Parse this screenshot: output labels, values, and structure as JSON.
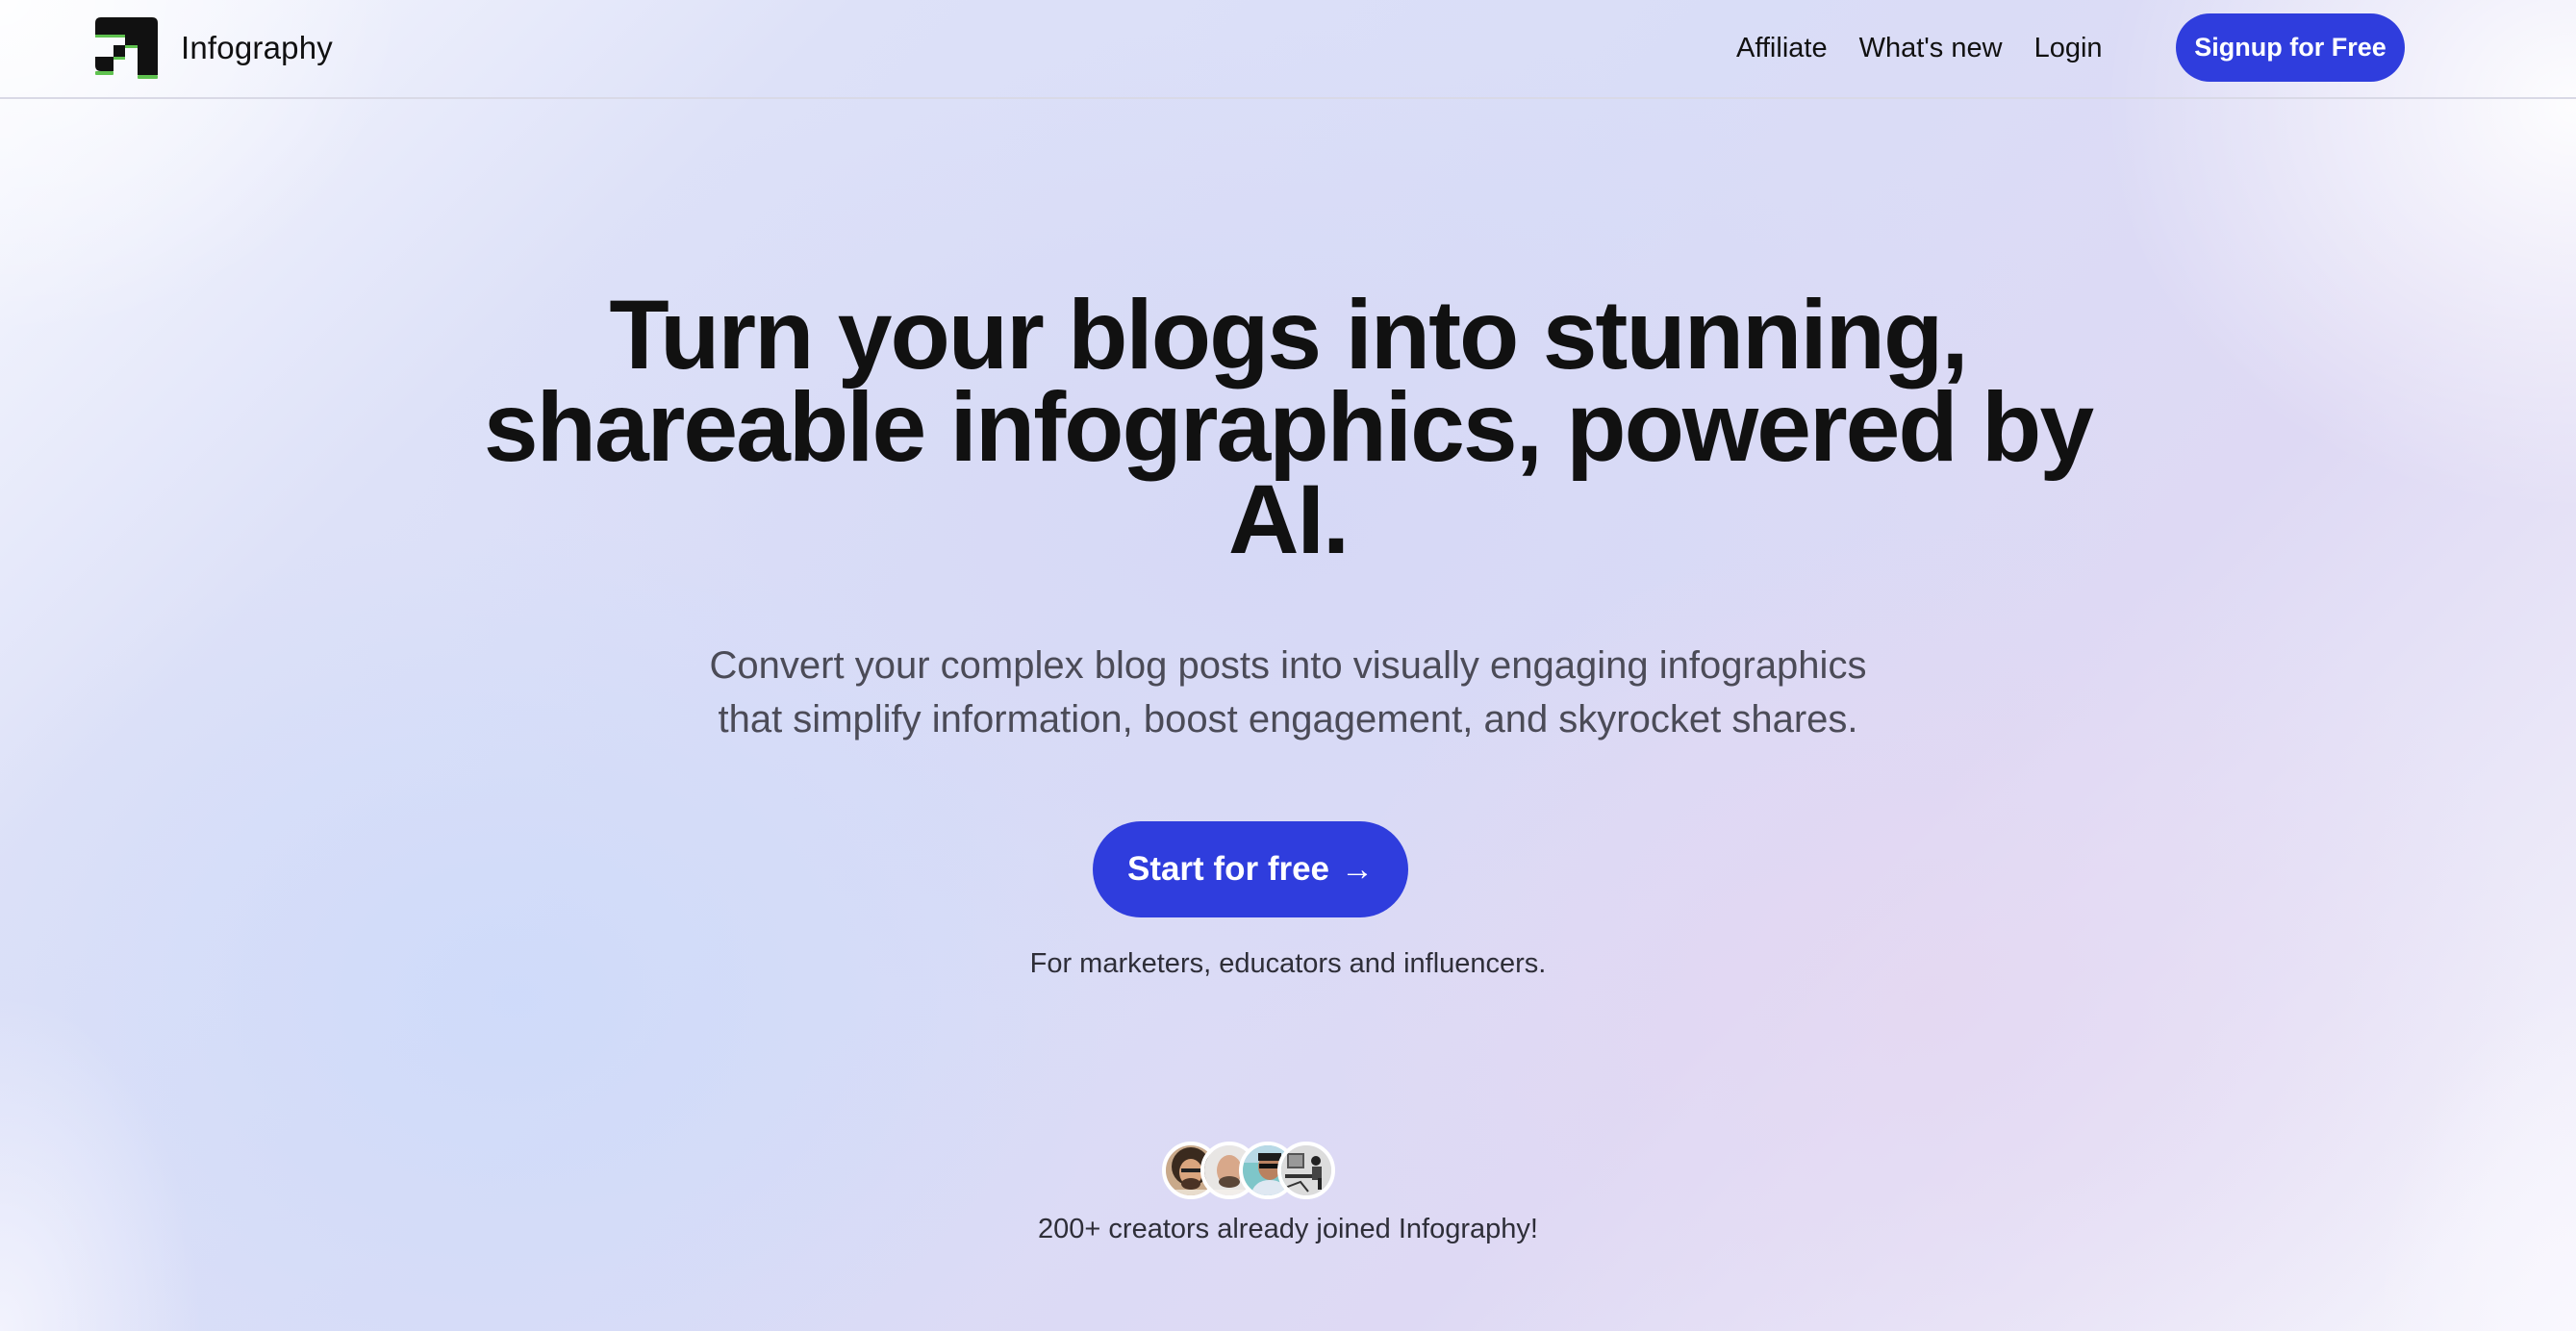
{
  "header": {
    "brand_name": "Infography",
    "logo_icon": "stepped-arrow-logo",
    "nav": [
      {
        "label": "Affiliate"
      },
      {
        "label": "What's new"
      },
      {
        "label": "Login"
      }
    ],
    "signup_label": "Signup for Free"
  },
  "hero": {
    "title_lines": [
      "Turn your blogs into stunning,",
      "shareable infographics, powered by",
      "AI."
    ],
    "subtitle_lines": [
      "Convert your complex blog posts into visually engaging infographics",
      "that simplify information, boost engagement, and skyrocket shares."
    ],
    "cta_label": "Start for free",
    "cta_icon": "arrow-right-icon",
    "cta_arrow": "→",
    "audience": "For marketers, educators and influencers.",
    "avatars": [
      {
        "name": "creator-avatar-1",
        "desc": "man with curly hair and glasses"
      },
      {
        "name": "creator-avatar-2",
        "desc": "bald man with beard"
      },
      {
        "name": "creator-avatar-3",
        "desc": "man with sunglasses at beach"
      },
      {
        "name": "creator-avatar-4",
        "desc": "sketch of person at desk"
      }
    ],
    "social_proof": "200+ creators already joined Infography!"
  },
  "colors": {
    "accent": "#2f3ddd",
    "logo_black": "#111111",
    "logo_green": "#5fc24f",
    "text_primary": "#111111",
    "text_secondary": "#4b4b57"
  }
}
